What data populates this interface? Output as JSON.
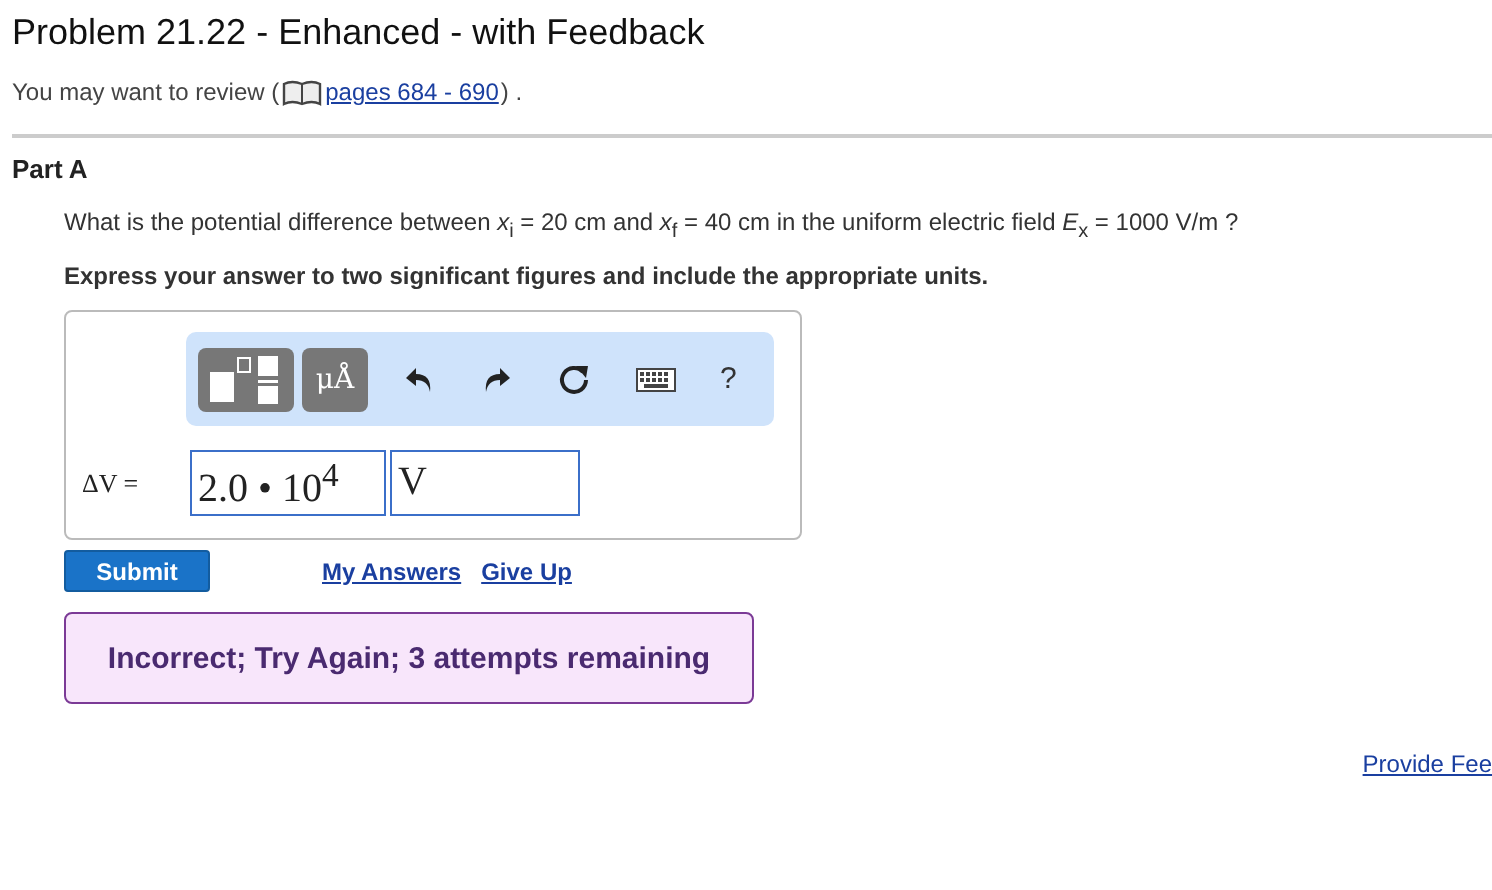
{
  "title": "Problem 21.22 - Enhanced - with Feedback",
  "review": {
    "prefix": "You may want to review (",
    "link": "pages 684 - 690",
    "suffix": ") ."
  },
  "part": {
    "title": "Part A",
    "question": "What is the potential difference between *x*$_{i}$ = 20  cm and *x*$_{f}$ = 40  cm in the uniform electric field *E*$_{x}$ = 1000  V/m ?",
    "instruction": "Express your answer to two significant figures and include the appropriate units.",
    "toolbar": [
      {
        "kind": "templates"
      },
      {
        "kind": "symbols",
        "label": "μÅ"
      },
      {
        "kind": "undo"
      },
      {
        "kind": "redo"
      },
      {
        "kind": "reset"
      },
      {
        "kind": "keyboard"
      },
      {
        "kind": "help",
        "label": "?"
      }
    ],
    "answer_label": "ΔV =",
    "value": "2.0 • 10$^{4}$",
    "units": "V",
    "submit": "Submit",
    "links": [
      "My Answers",
      "Give Up"
    ],
    "feedback": "Incorrect; Try Again; 3 attempts remaining"
  },
  "footer_link": "Provide Fee"
}
